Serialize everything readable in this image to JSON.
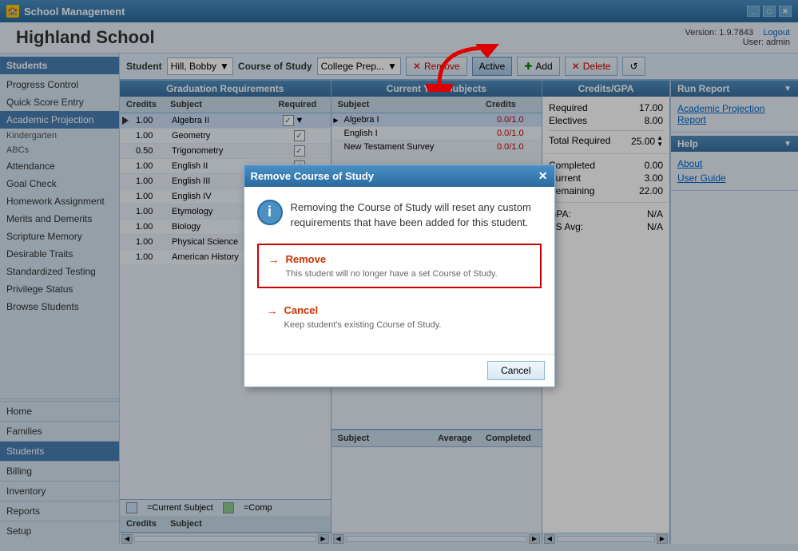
{
  "app": {
    "title": "School Management",
    "school_name": "Highland School",
    "version": "Version: 1.9.7843",
    "logout_label": "Logout",
    "user_label": "User: admin"
  },
  "sidebar": {
    "header": "Students",
    "items": [
      {
        "label": "Progress Control",
        "active": false
      },
      {
        "label": "Quick Score Entry",
        "active": false
      },
      {
        "label": "Academic Projection",
        "active": true
      },
      {
        "label": "Kindergarten",
        "active": false
      },
      {
        "label": "ABCs",
        "active": false
      },
      {
        "label": "Attendance",
        "active": false
      },
      {
        "label": "Goal Check",
        "active": false
      },
      {
        "label": "Homework Assignment",
        "active": false
      },
      {
        "label": "Merits and Demerits",
        "active": false
      },
      {
        "label": "Scripture Memory",
        "active": false
      },
      {
        "label": "Desirable Traits",
        "active": false
      },
      {
        "label": "Standardized Testing",
        "active": false
      },
      {
        "label": "Privilege Status",
        "active": false
      },
      {
        "label": "Browse Students",
        "active": false
      }
    ],
    "nav_items": [
      {
        "label": "Home",
        "active": false
      },
      {
        "label": "Families",
        "active": false
      },
      {
        "label": "Students",
        "active": true
      },
      {
        "label": "Billing",
        "active": false
      },
      {
        "label": "Inventory",
        "active": false
      },
      {
        "label": "Reports",
        "active": false
      },
      {
        "label": "Setup",
        "active": false
      }
    ]
  },
  "toolbar": {
    "student_label": "Student",
    "student_value": "Hill, Bobby",
    "course_of_study_label": "Course of Study",
    "course_value": "College Prep...",
    "remove_label": "Remove",
    "active_label": "Active",
    "add_label": "Add",
    "delete_label": "Delete"
  },
  "graduation_panel": {
    "header": "Graduation Requirements",
    "col_credits": "Credits",
    "col_subject": "Subject",
    "col_required": "Required",
    "rows": [
      {
        "credits": "1.00",
        "subject": "Algebra II",
        "required": true,
        "is_current": true
      },
      {
        "credits": "1.00",
        "subject": "Geometry",
        "required": true,
        "is_current": false
      },
      {
        "credits": "0.50",
        "subject": "Trigonometry",
        "required": true,
        "is_current": false
      },
      {
        "credits": "1.00",
        "subject": "English II",
        "required": true,
        "is_current": false
      },
      {
        "credits": "1.00",
        "subject": "English III",
        "required": true,
        "is_current": false
      },
      {
        "credits": "1.00",
        "subject": "English IV",
        "required": true,
        "is_current": false
      },
      {
        "credits": "1.00",
        "subject": "Etymology",
        "required": true,
        "is_current": false
      },
      {
        "credits": "1.00",
        "subject": "Biology",
        "required": true,
        "is_current": false
      },
      {
        "credits": "1.00",
        "subject": "Physical Science",
        "required": true,
        "is_current": false
      },
      {
        "credits": "1.00",
        "subject": "American History",
        "required": true,
        "is_current": false
      }
    ],
    "legend_current": "=Current Subject",
    "legend_completed": "=Comp"
  },
  "current_year_panel": {
    "header": "Current Year Subjects",
    "col_subject": "Subject",
    "col_credits": "Credits",
    "rows": [
      {
        "subject": "Algebra I",
        "credits": "0.0/1.0",
        "highlighted": true
      },
      {
        "subject": "English I",
        "credits": "0.0/1.0",
        "highlighted": false
      },
      {
        "subject": "New Testament Survey",
        "credits": "0.0/1.0",
        "highlighted": false
      }
    ]
  },
  "credits_gpa_panel": {
    "header": "Credits/GPA",
    "required_label": "Required",
    "required_value": "17.00",
    "electives_label": "Electives",
    "electives_value": "8.00",
    "total_required_label": "Total Required",
    "total_required_value": "25.00",
    "completed_label": "Completed",
    "completed_value": "0.00",
    "current_label": "Current",
    "current_value": "3.00",
    "remaining_label": "Remaining",
    "remaining_value": "22.00",
    "gpa_label": "GPA:",
    "gpa_value": "N/A",
    "hs_avg_label": "HS Avg:",
    "hs_avg_value": "N/A"
  },
  "run_report": {
    "header": "Run Report",
    "report_name": "Academic Projection Report"
  },
  "help": {
    "header": "Help",
    "links": [
      {
        "label": "About"
      },
      {
        "label": "User Guide"
      }
    ]
  },
  "modal": {
    "title": "Remove Course of Study",
    "info_text": "Removing the Course of Study will reset any custom requirements that have been added for this student.",
    "option_remove_title": "Remove",
    "option_remove_desc": "This student will no longer have a set Course of Study.",
    "option_cancel_title": "Cancel",
    "option_cancel_desc": "Keep student's existing Course of Study.",
    "cancel_btn": "Cancel"
  },
  "bottom_panel": {
    "col_credits": "Credits",
    "col_subject": "Subject",
    "col_average": "Average",
    "col_completed": "Completed"
  }
}
